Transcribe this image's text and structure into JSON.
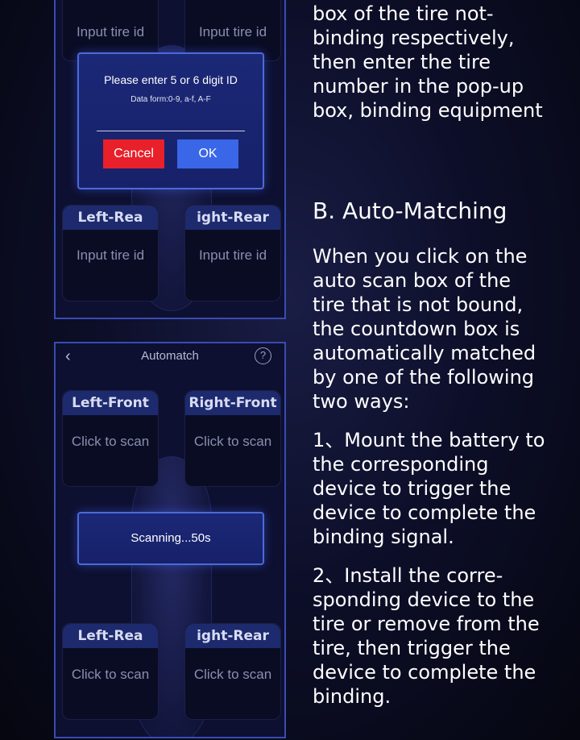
{
  "bind_dialog": {
    "title": "Please enter 5 or 6 digit ID",
    "hint": "Data form:0-9, a-f, A-F",
    "cancel_label": "Cancel",
    "ok_label": "OK"
  },
  "bind_screen": {
    "tires": {
      "front_left": {
        "body": "Input tire id"
      },
      "front_right": {
        "body": "Input tire id"
      },
      "rear_left": {
        "label": "Left-Rea",
        "body": "Input tire id"
      },
      "rear_right": {
        "label": "ight-Rear",
        "body": "Input tire id"
      }
    }
  },
  "automatch_screen": {
    "title": "Automatch",
    "tires": {
      "front_left": {
        "label": "Left-Front",
        "body": "Click to scan"
      },
      "front_right": {
        "label": "Right-Front",
        "body": "Click to scan"
      },
      "rear_left": {
        "label": "Left-Rea",
        "body": "Click to scan"
      },
      "rear_right": {
        "label": "ight-Rear",
        "body": "Click to scan"
      }
    },
    "scanning_text": "Scanning...50s"
  },
  "instructions": {
    "intro_lines": [
      "box of the tire not-",
      "binding respectively,",
      "then enter the tire",
      "number in the pop-up",
      "box, binding equipment"
    ],
    "heading": "B. Auto-Matching",
    "para1_lines": [
      "When you click on the",
      "auto scan box of the",
      "tire that is not bound,",
      "the countdown box is",
      "automatically matched",
      "by one of the following",
      "two ways:"
    ],
    "para2_lines": [
      "1、Mount the battery to",
      "the corresponding",
      "device to trigger the",
      "device to complete the",
      "binding signal."
    ],
    "para3_lines": [
      "2、Install the corre-",
      "sponding device to the",
      "tire or remove from the",
      "tire, then trigger the",
      "device to complete the",
      "binding."
    ]
  },
  "colors": {
    "accent_blue": "#3a66e8",
    "cancel_red": "#e8202a",
    "frame_border": "#3a4bb3",
    "tire_header": "#1e2a6e"
  },
  "icons": {
    "back": "back-arrow-icon",
    "help": "help-icon"
  }
}
